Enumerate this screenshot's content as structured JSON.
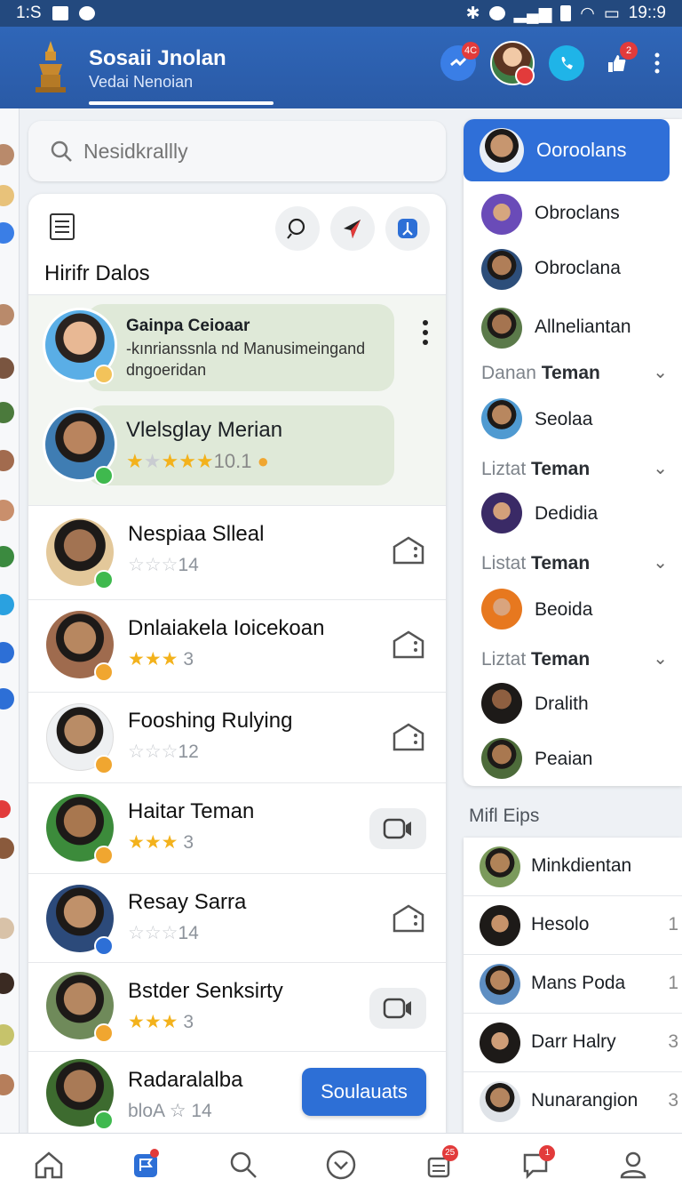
{
  "status_bar": {
    "carrier": "1:S",
    "time": "19::9"
  },
  "header": {
    "title": "Sosaii Jnolan",
    "subtitle": "Vedai Nenoian",
    "badge_count": "4C",
    "notif_count": "2"
  },
  "search": {
    "placeholder": "Nesidkrallly"
  },
  "card": {
    "title": "Hirifr Dalos",
    "featured": [
      {
        "name": "Gainpa Ceioaar",
        "line1": "-kınrianssnla nd Manusimeingand",
        "line2": "dngoeridan"
      },
      {
        "name": "Vlelsglay Merian",
        "rating": "10.1"
      }
    ],
    "rows": [
      {
        "name": "Nespiaa Slleal",
        "rating_text": "14",
        "stars_on": "",
        "stars_off": "☆☆☆"
      },
      {
        "name": "Dnlaiakela Ioicekoan",
        "rating_text": "3",
        "stars_on": "★★★",
        "stars_off": ""
      },
      {
        "name": "Fooshing Rulying",
        "rating_text": "12",
        "stars_on": "",
        "stars_off": "☆☆☆"
      },
      {
        "name": "Haitar Teman",
        "rating_text": "3",
        "stars_on": "★★★",
        "stars_off": ""
      },
      {
        "name": "Resay Sarra",
        "rating_text": "14",
        "stars_on": "",
        "stars_off": "☆☆☆"
      },
      {
        "name": "Bstder Senksirty",
        "rating_text": "3",
        "stars_on": "★★★",
        "stars_off": ""
      },
      {
        "name": "Radaralalba",
        "rating_text": "bloA ☆ 14",
        "action_label": "Soulauats"
      }
    ]
  },
  "right_panel": {
    "header": "Ooroolans",
    "items": [
      {
        "label": "Obroclans"
      },
      {
        "label": "Obroclana"
      },
      {
        "label": "Allneliantan"
      }
    ],
    "sections": [
      {
        "prefix": "Danan",
        "suffix": "Teman",
        "item": "Seolaa"
      },
      {
        "prefix": "Liztat",
        "suffix": "Teman",
        "item": "Dedidia"
      },
      {
        "prefix": "Listat",
        "suffix": "Teman",
        "item": "Beoida"
      },
      {
        "prefix": "Liztat",
        "suffix": "Teman",
        "item": "Dralith"
      }
    ],
    "last_item": "Peaian"
  },
  "mini_list": {
    "title": "Mifl Eips",
    "items": [
      {
        "label": "Minkdientan",
        "count": ""
      },
      {
        "label": "Hesolo",
        "count": "1"
      },
      {
        "label": "Mans Poda",
        "count": "1"
      },
      {
        "label": "Darr Halry",
        "count": "3"
      },
      {
        "label": "Nunarangion",
        "count": "3"
      }
    ]
  },
  "bottom_nav": {
    "badge_notes": "25",
    "badge_chat": "1"
  }
}
